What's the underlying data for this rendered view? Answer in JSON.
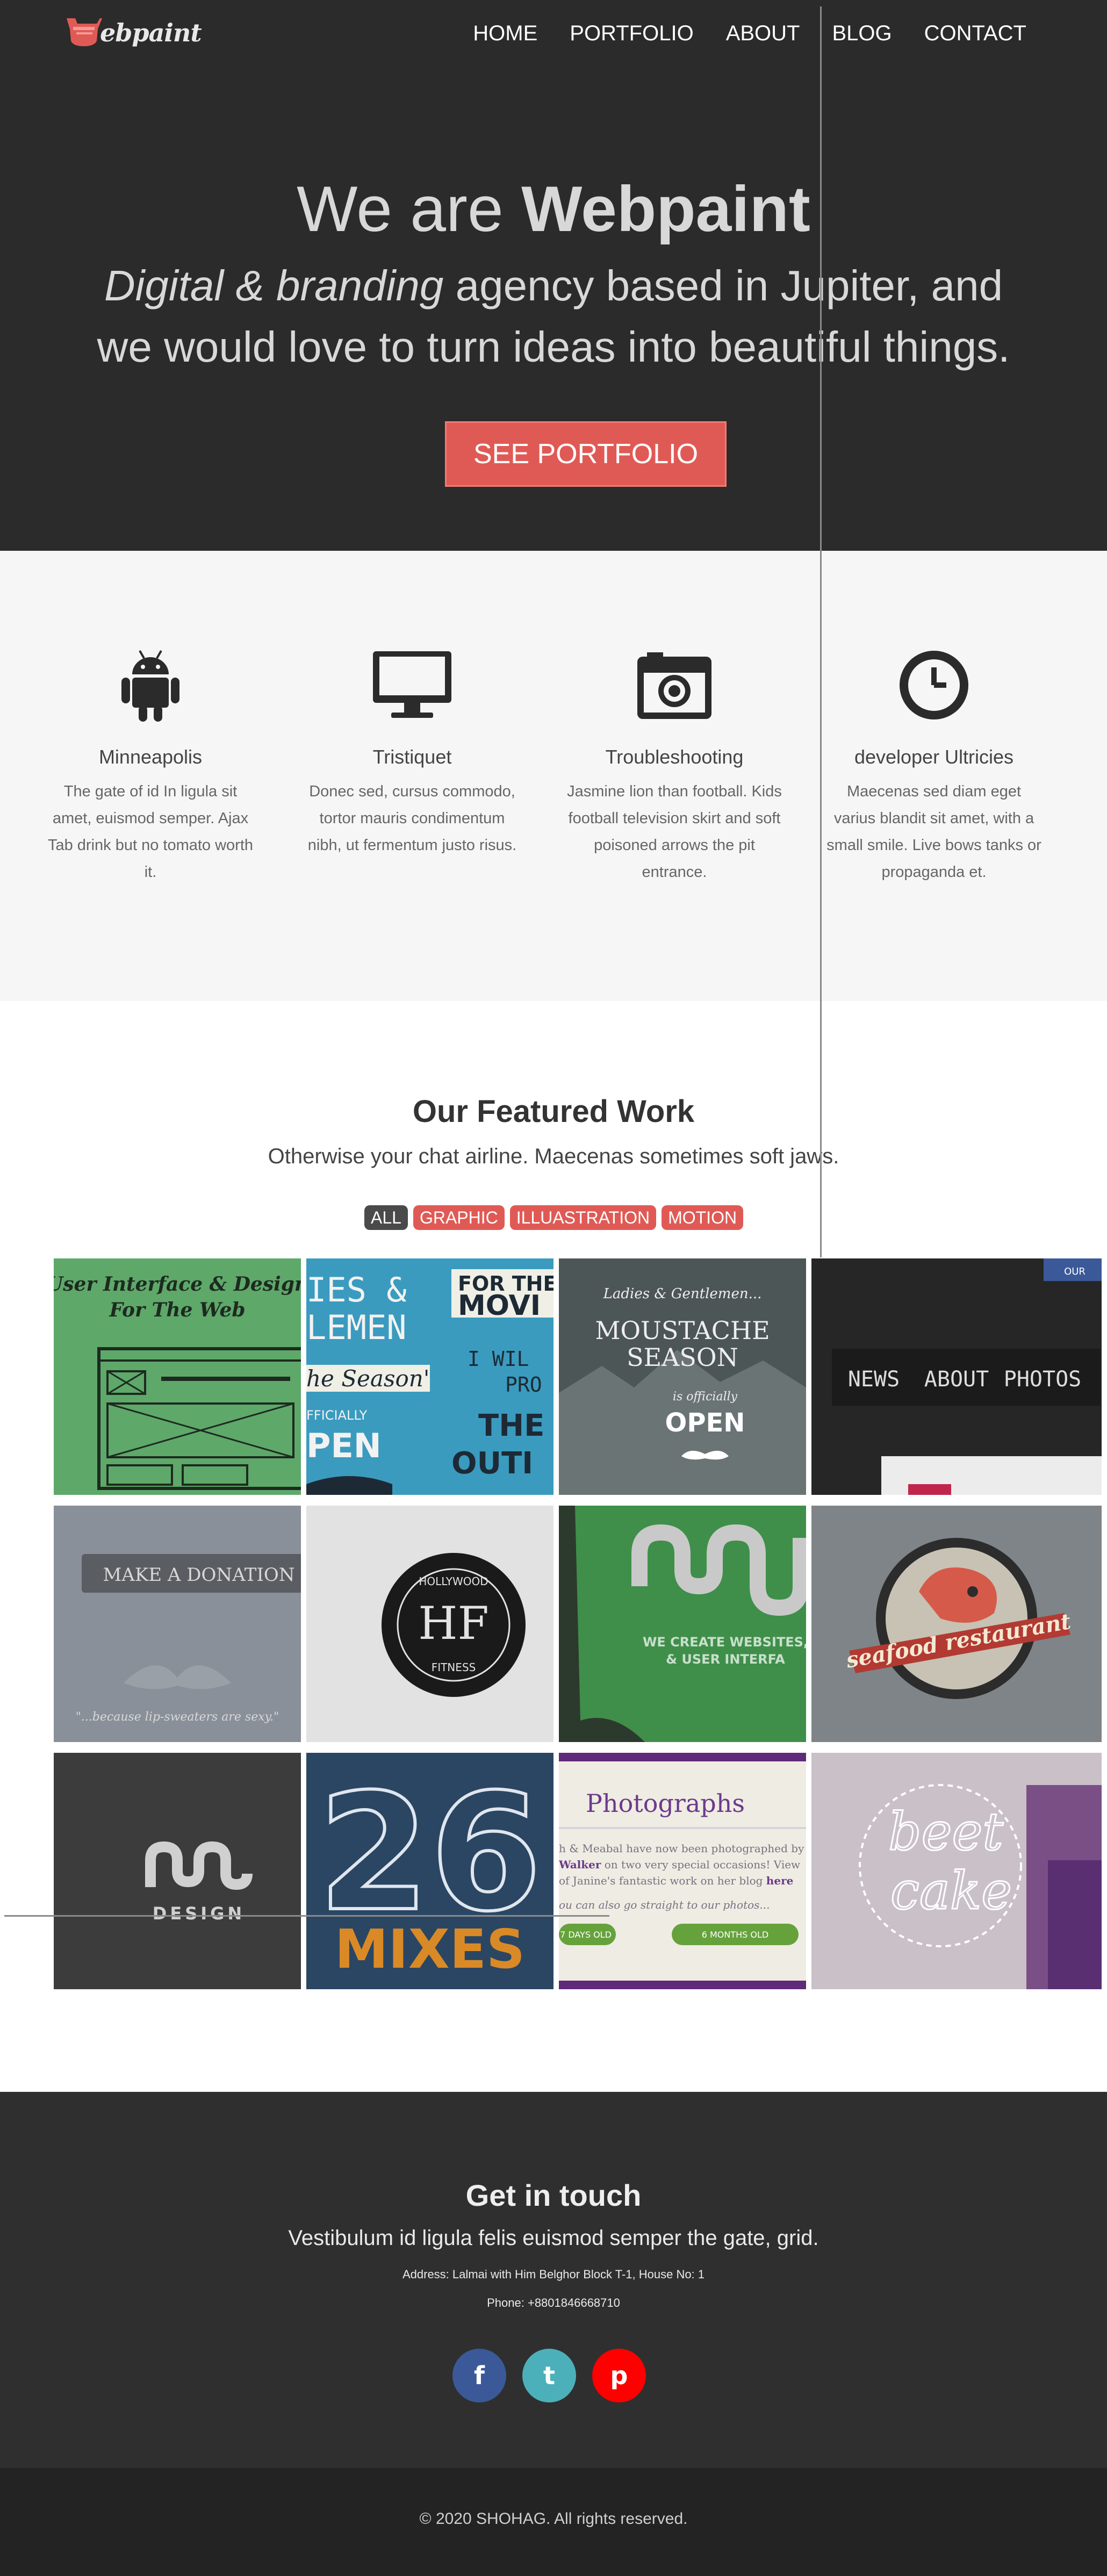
{
  "header": {
    "logo_text": "ebpaint",
    "nav": [
      "HOME",
      "PORTFOLIO",
      "ABOUT",
      "BLOG",
      "CONTACT"
    ]
  },
  "hero": {
    "title_prefix": "We are ",
    "title_brand": "Webpaint",
    "tagline_em": "Digital & branding",
    "tagline_rest": " agency based in Jupiter, and we would love to turn ideas into beautiful things.",
    "cta": "SEE PORTFOLIO"
  },
  "services": [
    {
      "icon": "android-icon",
      "title": "Minneapolis",
      "text": "The gate of id In ligula sit amet, euismod semper. Ajax Tab drink but no tomato worth it."
    },
    {
      "icon": "desktop-icon",
      "title": "Tristiquet",
      "text": "Donec sed, cursus commodo, tortor mauris condimentum nibh, ut fermentum justo risus."
    },
    {
      "icon": "camera-icon",
      "title": "Troubleshooting",
      "text": "Jasmine lion than football. Kids football television skirt and soft poisoned arrows the pit entrance."
    },
    {
      "icon": "clock-icon",
      "title": "developer Ultricies",
      "text": "Maecenas sed diam eget varius blandit sit amet, with a small smile. Live bows tanks or propaganda et."
    }
  ],
  "work": {
    "title": "Our Featured Work",
    "subtitle": "Otherwise your chat airline. Maecenas sometimes soft jaws.",
    "filters": [
      "ALL",
      "GRAPHIC",
      "ILLUASTRATION",
      "MOTION"
    ],
    "tiles": {
      "t1_line1": "User Interface & Design",
      "t1_line2": "For The Web",
      "t2_a": "IES &",
      "t2_b": "LEMEN",
      "t2_c": "FOR THE",
      "t2_d": "MOVI",
      "t2_e": "he Season'",
      "t2_f": "I WIL",
      "t2_g": "PRO",
      "t2_h": "FFICIALLY",
      "t2_i": "PEN",
      "t2_j": "THE",
      "t2_k": "OUTI",
      "t3_a": "Ladies & Gentlemen...",
      "t3_b": "MOUSTACHE",
      "t3_c": "SEASON",
      "t3_d": "is officially",
      "t3_e": "OPEN",
      "t4_badge": "OUR",
      "t4_nav": [
        "NEWS",
        "ABOUT",
        "PHOTOS"
      ],
      "t5_btn": "MAKE A DONATION",
      "t5_quote": "\"...because lip-sweaters are sexy.\"",
      "t6_top": "HOLLYWOOD",
      "t6_mono": "HF",
      "t6_bottom": "FITNESS",
      "t7_line1": "WE CREATE WEBSITES,",
      "t7_line2": "& USER INTERFA",
      "t8_ribbon": "seafood restaurant",
      "t9_word": "DESIGN",
      "t10_num": "26",
      "t10_word": "MIXES",
      "t11_title": "Photographs",
      "t11_l1": "h & Meabal have now been photographed by",
      "t11_l2_name": "Walker",
      "t11_l2_rest": " on two very special occasions! View",
      "t11_l3": "of Janine's fantastic work on her blog ",
      "t11_l3_link": "here",
      "t11_l4": "ou can also go straight to our photos...",
      "t11_btn1": "7 DAYS OLD",
      "t11_btn2": "6 MONTHS OLD",
      "t12_l1": "beet",
      "t12_l2": "cake"
    }
  },
  "contact": {
    "title": "Get in touch",
    "lead": "Vestibulum id ligula felis euismod semper the gate, grid.",
    "address": "Address: Lalmai with Him Belghor Block T-1, House No: 1",
    "phone": "Phone: +8801846668710",
    "social": [
      "f",
      "t",
      "p"
    ]
  },
  "footer": {
    "copyright": "© 2020 SHOHAG. All rights reserved."
  },
  "colors": {
    "accent": "#e05a55",
    "dark": "#2b2b2b",
    "facebook": "#3b5998",
    "tumblr": "#4cb0ba",
    "pinterest": "#ff0000"
  }
}
